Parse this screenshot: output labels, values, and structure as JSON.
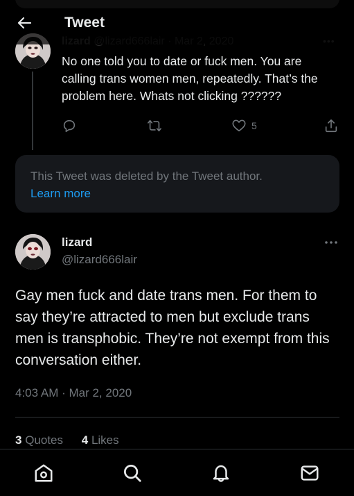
{
  "header": {
    "title": "Tweet"
  },
  "parent_tweet": {
    "ghost_name": "lizard",
    "ghost_meta": "@lizard666lair · Mar 2, 2020",
    "text": "No one told you to date or fuck men. You are calling trans women men, repeatedly. That’s the problem here. Whats not clicking ??????",
    "likes": "5"
  },
  "deleted_notice": {
    "text": "This Tweet was deleted by the Tweet author.",
    "link": "Learn more"
  },
  "main_tweet": {
    "name": "lizard",
    "handle": "@lizard666lair",
    "text": "Gay men fuck and date trans men. For them to say they’re attracted to men but exclude trans men is transphobic. They’re not exempt from this conversation either.",
    "timestamp": "4:03 AM · Mar 2, 2020",
    "quotes_count": "3",
    "quotes_label": "Quotes",
    "likes_count": "4",
    "likes_label": "Likes"
  },
  "colors": {
    "accent": "#1d9bf0",
    "muted": "#71767b",
    "text": "#e7e9ea",
    "background": "#000000"
  },
  "icons": [
    "back-arrow-icon",
    "reply-icon",
    "retweet-icon",
    "heart-icon",
    "share-icon",
    "more-icon",
    "home-icon",
    "search-icon",
    "bell-icon",
    "mail-icon"
  ]
}
